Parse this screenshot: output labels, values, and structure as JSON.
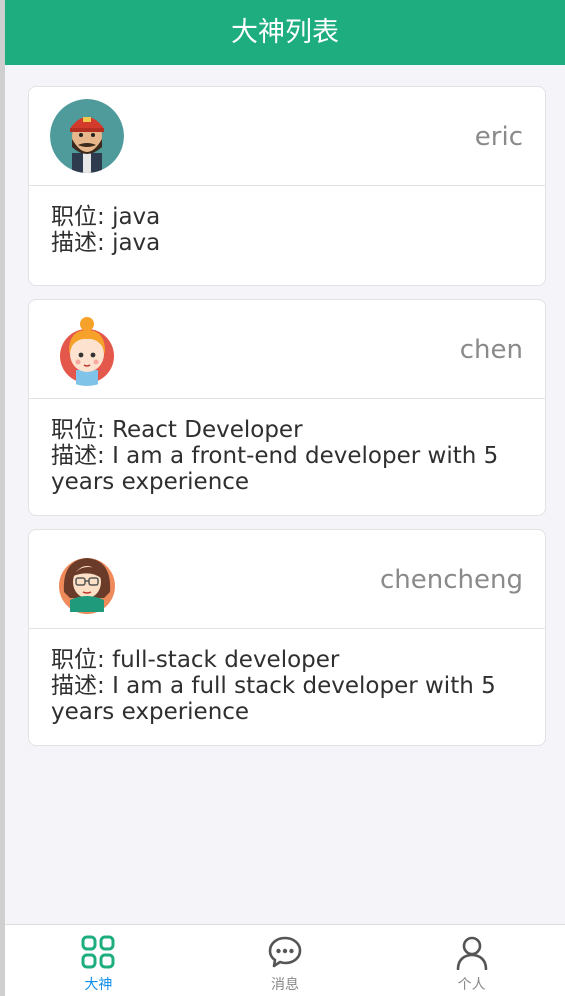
{
  "header": {
    "title": "大神列表"
  },
  "cards": [
    {
      "username": "eric",
      "avatar_icon": "bearded-man-avatar",
      "position_label": "职位: ",
      "position": "java",
      "desc_label": "描述: ",
      "desc": "java"
    },
    {
      "username": "chen",
      "avatar_icon": "girl-avatar",
      "position_label": "职位: ",
      "position": "React Developer",
      "desc_label": "描述: ",
      "desc": "I am a front-end developer with 5 years experience"
    },
    {
      "username": "chencheng",
      "avatar_icon": "woman-glasses-avatar",
      "position_label": "职位: ",
      "position": "full-stack developer",
      "desc_label": "描述: ",
      "desc": "I am a full stack developer with 5 years experience"
    }
  ],
  "tabbar": {
    "items": [
      {
        "label": "大神",
        "icon": "grid-icon",
        "active": true
      },
      {
        "label": "消息",
        "icon": "chat-bubble-icon",
        "active": false
      },
      {
        "label": "个人",
        "icon": "person-icon",
        "active": false
      }
    ],
    "active_color": "#108ee9",
    "inactive_color": "#888888",
    "active_icon_color": "#1dad7f"
  },
  "colors": {
    "header_bg": "#1dad7f",
    "page_bg": "#f5f5f9"
  }
}
